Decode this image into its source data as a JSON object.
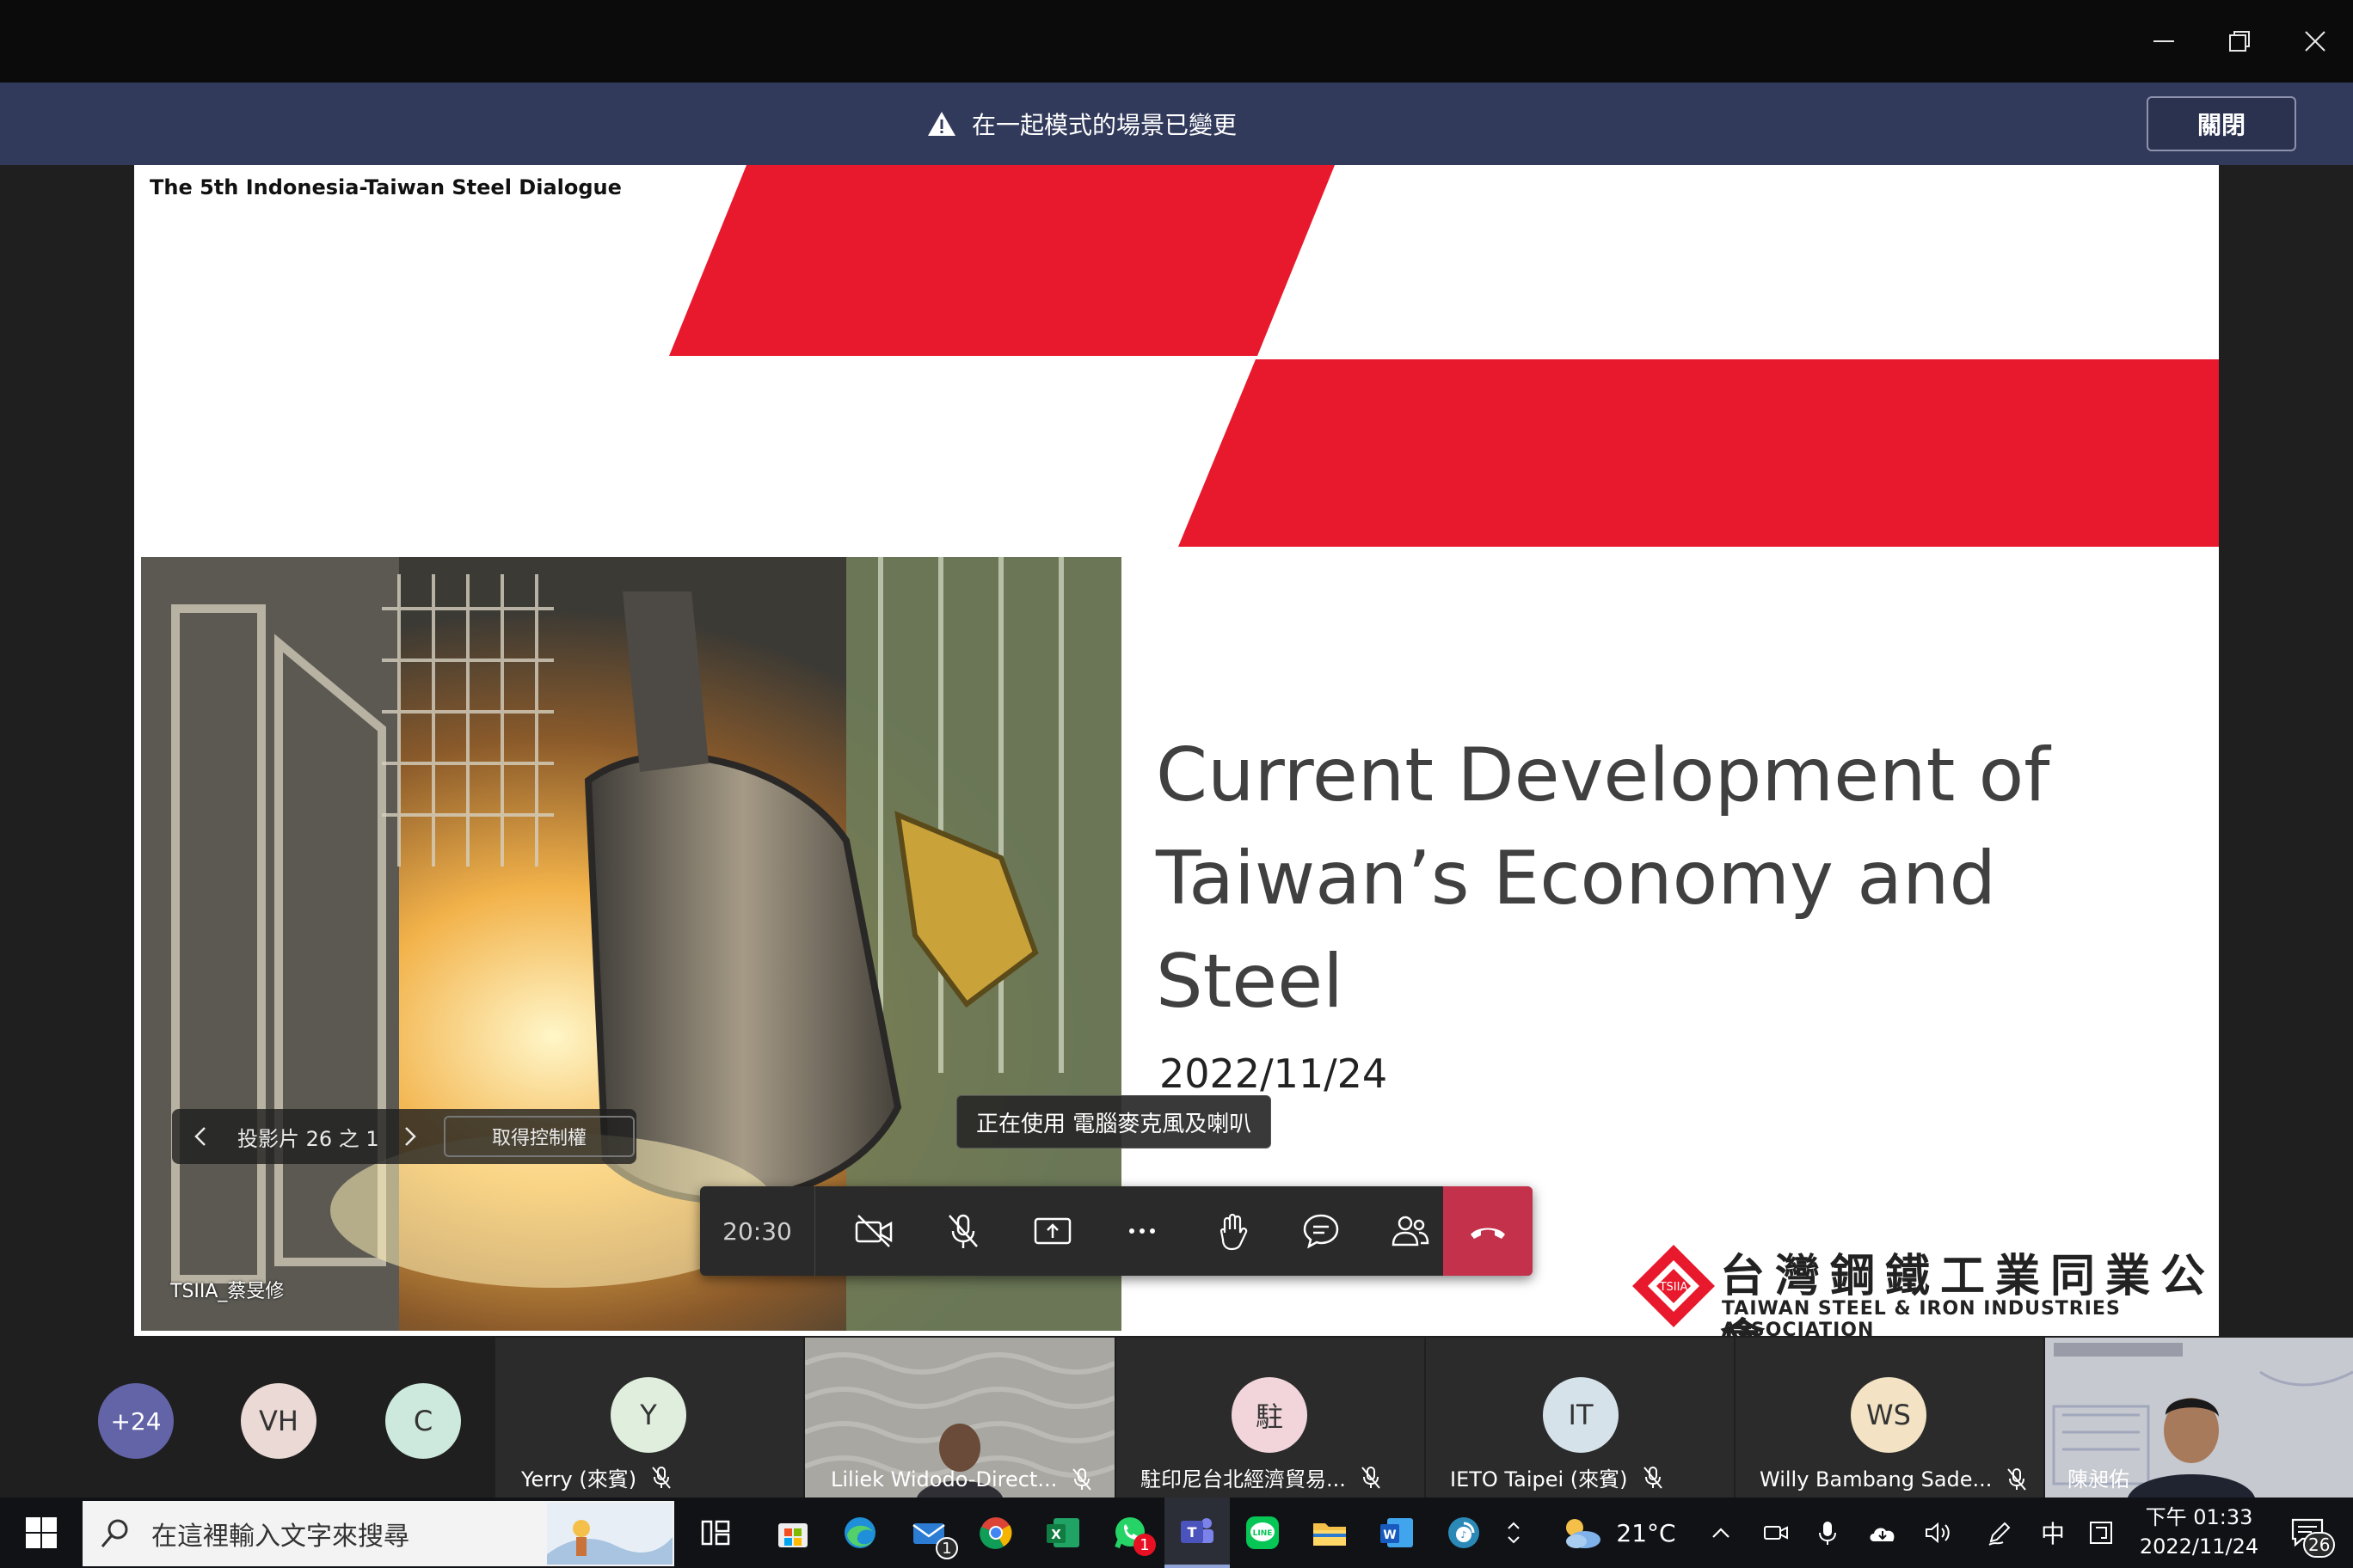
{
  "notice": {
    "text": "在一起模式的場景已變更",
    "close_label": "關閉"
  },
  "slide": {
    "header": "The 5th Indonesia-Taiwan Steel Dialogue",
    "title_line1": "Current Development of",
    "title_line2": "Taiwan’s Economy and Steel",
    "date": "2022/11/24",
    "logo_cn": "台灣鋼鐵工業同業公會",
    "logo_en": "TAIWAN STEEL & IRON INDUSTRIES ASSOCIATION",
    "logo_badge": "TSIIA",
    "presenter": "TSIIA_蔡旻修",
    "colors": {
      "accent_red": "#e8192c"
    }
  },
  "slide_nav": {
    "counter": "投影片 26 之 1",
    "take_control": "取得控制權"
  },
  "tooltip": "正在使用 電腦麥克風及喇叭",
  "call": {
    "timer": "20:30",
    "colors": {
      "hangup": "#c4314b"
    }
  },
  "participants": {
    "overflow": "+24",
    "avatars": [
      {
        "initials": "VH",
        "color": "#ead9d4"
      },
      {
        "initials": "C",
        "color": "#cde8dc"
      }
    ],
    "tiles": [
      {
        "initials": "Y",
        "color": "#dfeedd",
        "name": "Yerry (來賓)"
      },
      {
        "initials": "",
        "color": "",
        "name": "Liliek Widodo-Direct..."
      },
      {
        "initials": "駐",
        "color": "#f1d5da",
        "name": "駐印尼台北經濟貿易..."
      },
      {
        "initials": "IT",
        "color": "#d6e2ea",
        "name": "IETO Taipei (來賓)"
      },
      {
        "initials": "WS",
        "color": "#f3e3c4",
        "name": "Willy Bambang Sade..."
      },
      {
        "initials": "",
        "color": "",
        "name": "陳昶佑"
      }
    ]
  },
  "taskbar": {
    "search_placeholder": "在這裡輸入文字來搜尋",
    "weather": "21°C",
    "ime": "中",
    "time": "下午 01:33",
    "date": "2022/11/24",
    "notifications": "26",
    "mail_badge": "1",
    "whatsapp_badge": "1"
  }
}
